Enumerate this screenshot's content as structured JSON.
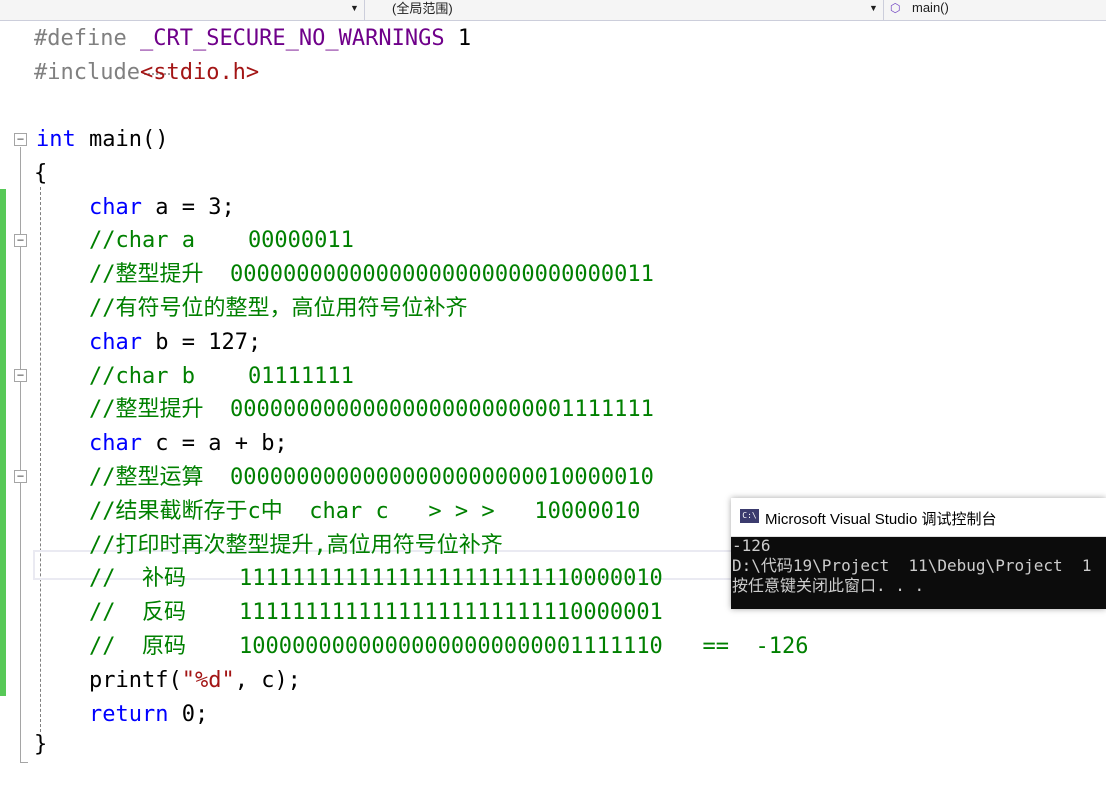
{
  "navbar": {
    "scope": "(全局范围)",
    "function": "main()"
  },
  "code": {
    "line1_directive": "#define",
    "line1_macro": "_CRT_SECURE_NO_WARNINGS",
    "line1_value": " 1",
    "line2_directive": "#include",
    "line2_header": "<stdio.h>",
    "line4_kw": "int",
    "line4_rest": " main()",
    "line5": "{",
    "line6_kw": "char",
    "line6_rest": " a = 3;",
    "line7": "//char a    00000011",
    "line8": "//整型提升  00000000000000000000000000000011",
    "line9": "//有符号位的整型，高位用符号位补齐",
    "line10_kw": "char",
    "line10_rest": " b = 127;",
    "line11": "//char b    01111111",
    "line12": "//整型提升  00000000000000000000000001111111",
    "line13_kw": "char",
    "line13_rest": " c = a + b;",
    "line14": "//整型运算  00000000000000000000000010000010",
    "line15": "//结果截断存于c中  char c   > > >   10000010",
    "line16": "//打印时再次整型提升,高位用符号位补齐",
    "line17": "//  补码    11111111111111111111111110000010",
    "line18": "//  反码    11111111111111111111111110000001",
    "line19": "//  原码    10000000000000000000000001111110   ==  -126",
    "line20_a": "printf(",
    "line20_str": "\"%d\"",
    "line20_b": ", c);",
    "line21_kw": "return",
    "line21_rest": " 0;",
    "line22": "}"
  },
  "console": {
    "icon": "C:\\",
    "title": "Microsoft Visual Studio 调试控制台",
    "lines": [
      "-126",
      "D:\\代码19\\Project  11\\Debug\\Project  1",
      "按任意键关闭此窗口. . ."
    ]
  }
}
